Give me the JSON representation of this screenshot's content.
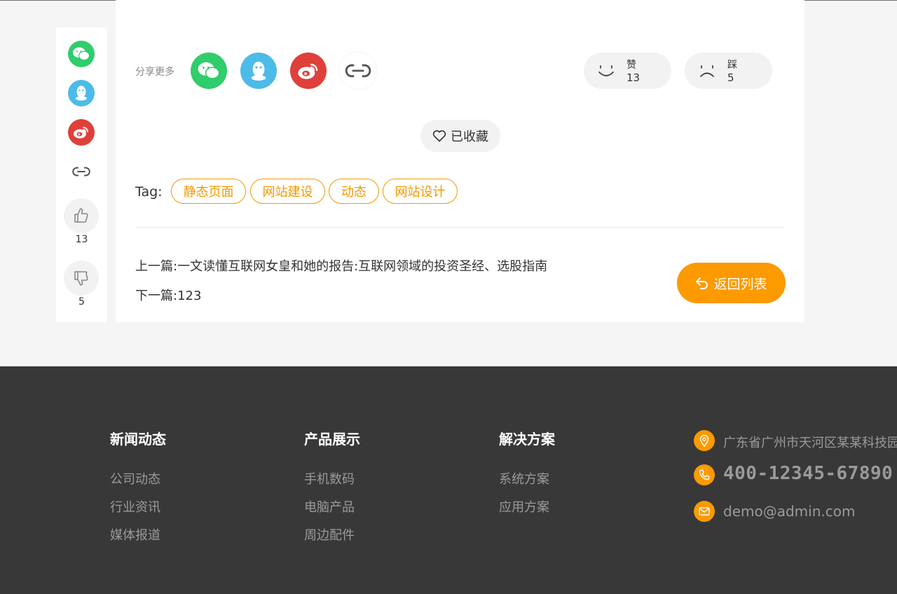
{
  "side_bar": {
    "like_count": "13",
    "dislike_count": "5"
  },
  "share": {
    "label": "分享更多",
    "icons": [
      "wechat-icon",
      "qq-icon",
      "weibo-icon",
      "link-icon"
    ]
  },
  "votes": {
    "like_label": "赞",
    "like_count": "13",
    "dislike_label": "踩",
    "dislike_count": "5"
  },
  "favorite": {
    "label": "已收藏"
  },
  "tags": {
    "label": "Tag:",
    "items": [
      "静态页面",
      "网站建设",
      "动态",
      "网站设计"
    ]
  },
  "article_nav": {
    "prev": "上一篇:一文读懂互联网女皇和她的报告:互联网领域的投资圣经、选股指南",
    "next": "下一篇:123",
    "back_label": "返回列表"
  },
  "footer": {
    "columns": [
      {
        "title": "新闻动态",
        "links": [
          "公司动态",
          "行业资讯",
          "媒体报道"
        ]
      },
      {
        "title": "产品展示",
        "links": [
          "手机数码",
          "电脑产品",
          "周边配件"
        ]
      },
      {
        "title": "解决方案",
        "links": [
          "系统方案",
          "应用方案"
        ]
      }
    ],
    "contact": {
      "address": "广东省广州市天河区某某科技园",
      "phone": "400-12345-67890",
      "email": "demo@admin.com"
    }
  },
  "colors": {
    "accent": "#fd9a00",
    "tag": "#f39800",
    "wechat": "#2fcd6b",
    "qq": "#4cbbe8",
    "weibo": "#e0403a",
    "footer_bg": "#383838"
  }
}
